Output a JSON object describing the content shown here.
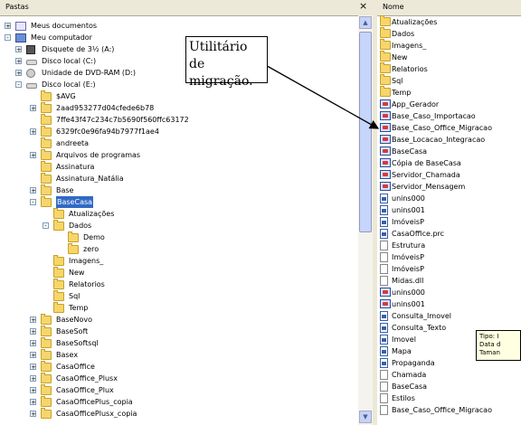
{
  "left_panel": {
    "header": "Pastas",
    "close_glyph": "×",
    "tree": [
      {
        "label": "Meus documentos",
        "icon": "documents-folder-icon",
        "exp": "+"
      },
      {
        "label": "Meu computador",
        "icon": "computer-icon",
        "exp": "-"
      },
      {
        "label": "Disquete de 3½ (A:)",
        "icon": "floppy-drive-icon",
        "exp": "+"
      },
      {
        "label": "Disco local (C:)",
        "icon": "hard-drive-icon",
        "exp": "+"
      },
      {
        "label": "Unidade de DVD-RAM (D:)",
        "icon": "dvd-drive-icon",
        "exp": "+"
      },
      {
        "label": "Disco local (E:)",
        "icon": "hard-drive-icon",
        "exp": "-"
      },
      {
        "label": "$AVG",
        "icon": "folder-icon",
        "exp": ""
      },
      {
        "label": "2aad953277d04cfede6b78",
        "icon": "folder-icon",
        "exp": "+"
      },
      {
        "label": "7ffe43f47c234c7b5690f560ffc63172",
        "icon": "folder-icon",
        "exp": ""
      },
      {
        "label": "6329fc0e96fa94b7977f1ae4",
        "icon": "folder-icon",
        "exp": "+"
      },
      {
        "label": "andreeta",
        "icon": "folder-icon",
        "exp": ""
      },
      {
        "label": "Arquivos de programas",
        "icon": "folder-icon",
        "exp": "+"
      },
      {
        "label": "Assinatura",
        "icon": "folder-icon",
        "exp": ""
      },
      {
        "label": "Assinatura_Natália",
        "icon": "folder-icon",
        "exp": ""
      },
      {
        "label": "Base",
        "icon": "folder-icon",
        "exp": "+"
      },
      {
        "label": "BaseCasa",
        "icon": "folder-open-icon",
        "exp": "-",
        "selected": true
      },
      {
        "label": "Atualizações",
        "icon": "folder-icon",
        "exp": ""
      },
      {
        "label": "Dados",
        "icon": "folder-icon",
        "exp": "-"
      },
      {
        "label": "Demo",
        "icon": "folder-icon",
        "exp": ""
      },
      {
        "label": "zero",
        "icon": "folder-icon",
        "exp": ""
      },
      {
        "label": "Imagens_",
        "icon": "folder-icon",
        "exp": ""
      },
      {
        "label": "New",
        "icon": "folder-icon",
        "exp": ""
      },
      {
        "label": "Relatorios",
        "icon": "folder-icon",
        "exp": ""
      },
      {
        "label": "Sql",
        "icon": "folder-icon",
        "exp": ""
      },
      {
        "label": "Temp",
        "icon": "folder-icon",
        "exp": ""
      },
      {
        "label": "BaseNovo",
        "icon": "folder-icon",
        "exp": "+"
      },
      {
        "label": "BaseSoft",
        "icon": "folder-icon",
        "exp": "+"
      },
      {
        "label": "BaseSoftsql",
        "icon": "folder-icon",
        "exp": "+"
      },
      {
        "label": "Basex",
        "icon": "folder-icon",
        "exp": "+"
      },
      {
        "label": "CasaOffice",
        "icon": "folder-icon",
        "exp": "+"
      },
      {
        "label": "CasaOffice_Plusx",
        "icon": "folder-icon",
        "exp": "+"
      },
      {
        "label": "CasaOffice_Plux",
        "icon": "folder-icon",
        "exp": "+"
      },
      {
        "label": "CasaOfficePlus_copia",
        "icon": "folder-icon",
        "exp": "+"
      },
      {
        "label": "CasaOfficePlusx_copia",
        "icon": "folder-icon",
        "exp": "+"
      }
    ]
  },
  "right_panel": {
    "header": "Nome",
    "items": [
      {
        "label": "Atualizações",
        "icon": "folder-icon"
      },
      {
        "label": "Dados",
        "icon": "folder-icon"
      },
      {
        "label": "Imagens_",
        "icon": "folder-icon"
      },
      {
        "label": "New",
        "icon": "folder-icon"
      },
      {
        "label": "Relatorios",
        "icon": "folder-icon"
      },
      {
        "label": "Sql",
        "icon": "folder-icon"
      },
      {
        "label": "Temp",
        "icon": "folder-icon"
      },
      {
        "label": "App_Gerador",
        "icon": "exe-icon"
      },
      {
        "label": "Base_Caso_Importacao",
        "icon": "exe-icon"
      },
      {
        "label": "Base_Caso_Office_Migracao",
        "icon": "exe-icon"
      },
      {
        "label": "Base_Locacao_Integracao",
        "icon": "exe-icon"
      },
      {
        "label": "BaseCasa",
        "icon": "exe-icon"
      },
      {
        "label": "Cópia de BaseCasa",
        "icon": "exe-icon"
      },
      {
        "label": "Servidor_Chamada",
        "icon": "exe-icon"
      },
      {
        "label": "Servidor_Mensagem",
        "icon": "exe-icon"
      },
      {
        "label": "unins000",
        "icon": "document-icon"
      },
      {
        "label": "unins001",
        "icon": "document-icon"
      },
      {
        "label": "ImóveisP",
        "icon": "document-icon"
      },
      {
        "label": "CasaOffice.prc",
        "icon": "document-icon"
      },
      {
        "label": "Estrutura",
        "icon": "file-icon"
      },
      {
        "label": "ImóveisP",
        "icon": "file-icon"
      },
      {
        "label": "ImóveisP",
        "icon": "file-icon"
      },
      {
        "label": "Midas.dll",
        "icon": "dll-icon"
      },
      {
        "label": "unins000",
        "icon": "exe-icon"
      },
      {
        "label": "unins001",
        "icon": "exe-icon"
      },
      {
        "label": "Consulta_Imovel",
        "icon": "document-icon"
      },
      {
        "label": "Consulta_Texto",
        "icon": "document-icon"
      },
      {
        "label": "Imovel",
        "icon": "document-icon"
      },
      {
        "label": "Mapa",
        "icon": "document-icon"
      },
      {
        "label": "Propaganda",
        "icon": "document-icon"
      },
      {
        "label": "Chamada",
        "icon": "file-icon"
      },
      {
        "label": "BaseCasa",
        "icon": "file-icon"
      },
      {
        "label": "Estilos",
        "icon": "file-icon"
      },
      {
        "label": "Base_Caso_Office_Migracao",
        "icon": "file-icon"
      }
    ]
  },
  "callout": {
    "text": "Utilitário de migração."
  },
  "tooltip": {
    "lines": [
      "Tipo: I",
      "Data d",
      "Taman"
    ]
  }
}
